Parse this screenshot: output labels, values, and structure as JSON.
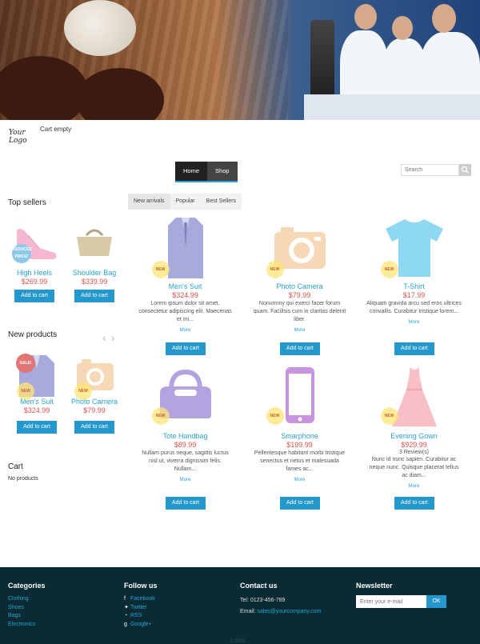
{
  "header": {
    "logo_text": "Your Logo",
    "cart_status": "Cart empty"
  },
  "nav": {
    "tabs": [
      "Home",
      "Shop"
    ],
    "active": "Home"
  },
  "search": {
    "placeholder": "Search",
    "button_icon": "search-icon"
  },
  "sidebar": {
    "top_sellers_title": "Top sellers",
    "top_sellers": [
      {
        "name": "High Heels",
        "price": "$269.99",
        "button": "Add to cart",
        "badge": "REDUCED PRICE!"
      },
      {
        "name": "Shoulder Bag",
        "price": "$339.99",
        "button": "Add to cart"
      }
    ],
    "new_products_title": "New products",
    "new_products": [
      {
        "name": "Men's Suit",
        "price": "$324.99",
        "button": "Add to cart",
        "badge_sale": "SALE!",
        "badge_new": "NEW"
      },
      {
        "name": "Photo Camera",
        "price": "$79.99",
        "button": "Add to cart",
        "badge_new": "NEW"
      }
    ],
    "cart_title": "Cart",
    "cart_text": "No products"
  },
  "product_tabs": [
    "New arrivals",
    "Popular",
    "Best Sellers"
  ],
  "products": [
    {
      "name": "Men's Suit",
      "price": "$324.99",
      "desc": "Lorem ipsum dolor sit amet, consectetur adipiscing elit. Maecenas et mi...",
      "more": "More",
      "button": "Add to cart",
      "badge": "NEW"
    },
    {
      "name": "Photo Camera",
      "price": "$79.99",
      "desc": "Nonummy qui exerci facer forum quam. Facilisis cum in claritas delenit liber.",
      "more": "More",
      "button": "Add to cart",
      "badge": "NEW"
    },
    {
      "name": "T-Shirt",
      "price": "$17.99",
      "desc": "Aliquam gravida arcu sed eros ultrices convallis. Curabitur tristique lorem...",
      "more": "More",
      "button": "Add to cart",
      "badge": "NEW"
    },
    {
      "name": "Tote Handbag",
      "price": "$89.99",
      "desc": "Nullam purus neque, sagittis luctus nisl ut, viverra dignissim felis. Nullam...",
      "more": "More",
      "button": "Add to cart",
      "badge": "NEW"
    },
    {
      "name": "Smarphone",
      "price": "$199.99",
      "desc": "Pellentesque habitant morbi tristique senectus et netus et malesuada fames ac...",
      "more": "More",
      "button": "Add to cart",
      "badge": "NEW"
    },
    {
      "name": "Evening Gown",
      "price": "$929.99",
      "reviews": "3 Review(s)",
      "desc": "Nunc id nunc sapien. Curabitur ac neque nunc. Quisque placerat tellus ac diam...",
      "more": "More",
      "button": "Add to cart",
      "badge": "NEW"
    }
  ],
  "footer": {
    "categories_title": "Categories",
    "categories": [
      "Clothing",
      "Shoes",
      "Bags",
      "Electronics"
    ],
    "follow_title": "Follow us",
    "follow": [
      "Facebook",
      "Twitter",
      "RSS",
      "Google+"
    ],
    "contact_title": "Contact us",
    "tel": "Tel: 0123-456-789",
    "email_label": "Email:",
    "email": "sales@yourcompany.com",
    "newsletter_title": "Newsletter",
    "newsletter_placeholder": "Enter your e-mail",
    "newsletter_button": "OK",
    "copyright": "© 2015 ..."
  },
  "colors": {
    "accent": "#2498cc",
    "price": "#d9534f",
    "footer_bg": "#0a2b33",
    "nav_bg": "#444444"
  }
}
